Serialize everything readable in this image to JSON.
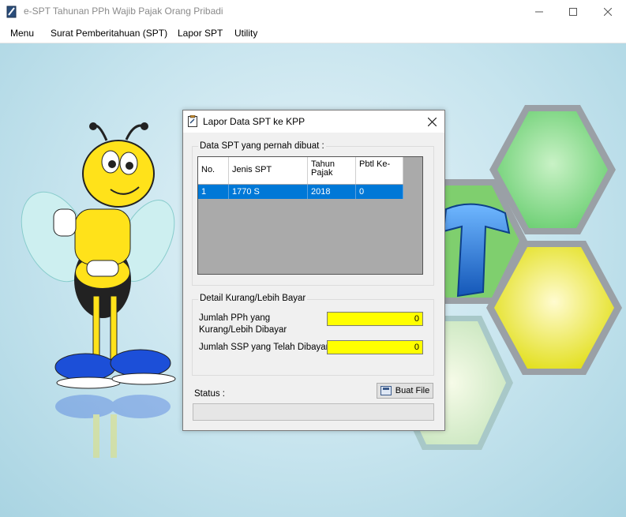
{
  "window": {
    "title": "e-SPT Tahunan PPh Wajib Pajak Orang Pribadi"
  },
  "menu": [
    "Menu",
    "Surat Pemberitahuan (SPT)",
    "Lapor SPT",
    "Utility"
  ],
  "dialog": {
    "title": "Lapor Data SPT ke KPP",
    "spt_group_label": "Data SPT yang pernah dibuat :",
    "table": {
      "headers": [
        "No.",
        "Jenis SPT",
        "Tahun Pajak",
        "Pbtl Ke-"
      ],
      "rows": [
        [
          "1",
          "1770 S",
          "2018",
          "0"
        ]
      ]
    },
    "detail_group_label": "Detail Kurang/Lebih Bayar",
    "kurang_lebih_label": "Jumlah PPh yang Kurang/Lebih Dibayar",
    "kurang_lebih_value": "0",
    "ssp_label": "Jumlah SSP yang Telah Dibayar",
    "ssp_value": "0",
    "button_label": "Buat File",
    "status_label": "Status :"
  },
  "colors": {
    "accent": "#0078d7",
    "field_bg": "#ffff00",
    "background": "#a9d4e2"
  }
}
